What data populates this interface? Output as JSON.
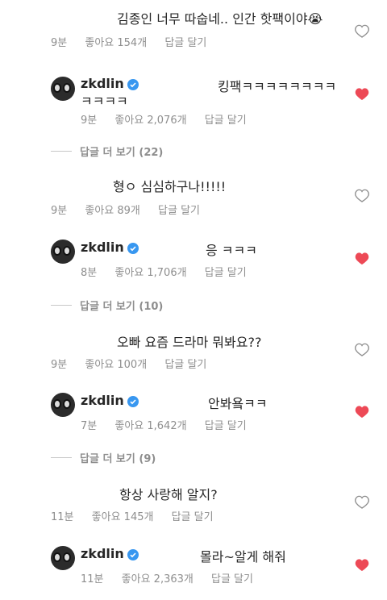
{
  "colors": {
    "text": "#262626",
    "meta": "#8e8e8e",
    "heart_red": "#ed4956",
    "verified_blue": "#3897f0"
  },
  "comments": [
    {
      "text": "김종인 너무 따숩네.. 인간 핫팩이야😭",
      "time": "9분",
      "likes": "좋아요 154개",
      "reply_label": "답글 달기",
      "liked": false,
      "reply": {
        "username": "zkdlin",
        "text_line1": "킹팩ㅋㅋㅋㅋㅋㅋㅋㅋ",
        "text_line2": "ㅋㅋㅋㅋ",
        "time": "9분",
        "likes": "좋아요 2,076개",
        "reply_label": "답글 달기",
        "liked": true
      },
      "view_more": "답글 더 보기 (22)"
    },
    {
      "text": "형ㅇ 심심하구나!!!!!",
      "time": "9분",
      "likes": "좋아요 89개",
      "reply_label": "답글 달기",
      "liked": false,
      "reply": {
        "username": "zkdlin",
        "text_line1": "응 ㅋㅋㅋ",
        "time": "8분",
        "likes": "좋아요 1,706개",
        "reply_label": "답글 달기",
        "liked": true
      },
      "view_more": "답글 더 보기 (10)"
    },
    {
      "text": "오빠 요즘 드라마 뭐봐요??",
      "time": "9분",
      "likes": "좋아요 100개",
      "reply_label": "답글 달기",
      "liked": false,
      "reply": {
        "username": "zkdlin",
        "text_line1": "안봐욬ㅋㅋ",
        "time": "7분",
        "likes": "좋아요 1,642개",
        "reply_label": "답글 달기",
        "liked": true
      },
      "view_more": "답글 더 보기 (9)"
    },
    {
      "text": "항상 사랑해 알지?",
      "time": "11분",
      "likes": "좋아요 145개",
      "reply_label": "답글 달기",
      "liked": false,
      "reply": {
        "username": "zkdlin",
        "text_line1": "몰라~알게 해줘",
        "time": "11분",
        "likes": "좋아요 2,363개",
        "reply_label": "답글 달기",
        "liked": true
      }
    }
  ]
}
